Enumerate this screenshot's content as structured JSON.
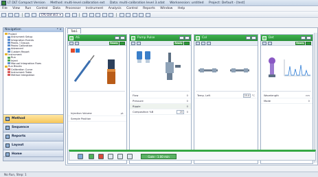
{
  "window": {
    "title_parts": [
      "LT DLT Compact Version",
      "Method: multi-level calibration ext",
      "Data: multi-calibration level 3.sdat",
      "Worksession: untitled",
      "Project: Default - [test]"
    ]
  },
  "menu": [
    "File",
    "View",
    "Run",
    "Control",
    "Data",
    "Processor",
    "Instrument",
    "Analysis",
    "Control",
    "Reports",
    "Window",
    "Help"
  ],
  "toolbar": {
    "combo_value": "CPL-Dat ok3. ▾"
  },
  "sidebar": {
    "title": "Navigation",
    "pin": "ᵖ ×",
    "tree": [
      "Project",
      "Instrument Setup",
      "Integration Events",
      "Peaks / Groups",
      "Peaks Calibration",
      "Advanced",
      "Custom Report",
      "Instrument",
      "Run",
      "Inject",
      "Manual Integration Fixes",
      "Run Blocks",
      "Calibration Curve",
      "Instrument Table",
      "Method Integration"
    ],
    "buttons": [
      {
        "label": "Method",
        "active": true
      },
      {
        "label": "Sequence",
        "active": false
      },
      {
        "label": "Reports",
        "active": false
      },
      {
        "label": "Layout",
        "active": false
      },
      {
        "label": "Home",
        "active": false
      }
    ]
  },
  "document_tab": "Tab1",
  "panels": [
    {
      "title": "AS",
      "status_btn": "Ready",
      "rows": [
        {
          "label": "Injection Volume",
          "value": "µL"
        },
        {
          "label": "Sample Position",
          "value": ""
        }
      ]
    },
    {
      "title": "Pump Pulse",
      "status_btn": "Ready",
      "rows": [
        {
          "label": "Flow",
          "value": "0"
        },
        {
          "label": "Pressure",
          "value": "0"
        },
        {
          "label": "Ripple",
          "value": "0"
        },
        {
          "label": "Composition %B",
          "value": "0",
          "box": "20"
        }
      ]
    },
    {
      "title": "Col",
      "status_btn": "",
      "rows": [
        {
          "label": "Temp. Left",
          "value": "°C",
          "box": "25.0"
        }
      ]
    },
    {
      "title": "Det",
      "status_btn": "Ready",
      "rows": [
        {
          "label": "Wavelength",
          "value": "nm"
        },
        {
          "label": "Mode",
          "value": "0"
        }
      ]
    }
  ],
  "bottombar": {
    "value": "Gate - 1.00 min"
  },
  "status": "No Run, Step: 1",
  "colors": {
    "accent_green": "#35a844",
    "header_green": "#2a8f3a",
    "active_nav": "#f7c75a",
    "panel_border": "#9fb0c6"
  }
}
